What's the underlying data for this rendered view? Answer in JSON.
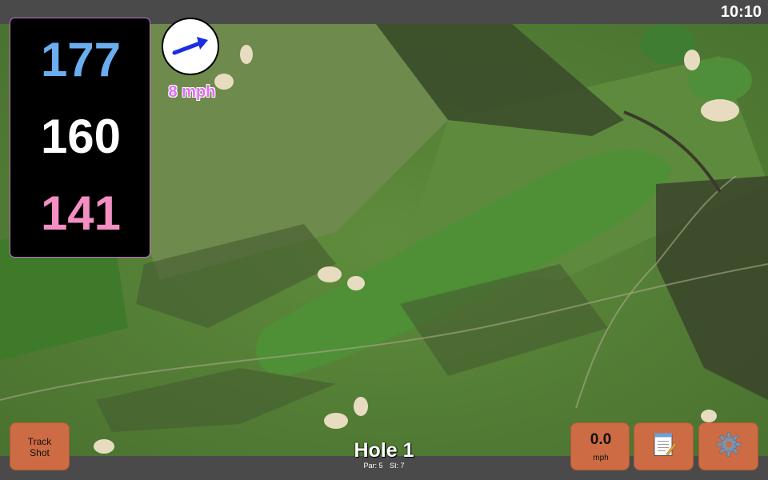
{
  "status": {
    "time": "10:10"
  },
  "distances": {
    "back": "177",
    "middle": "160",
    "front": "141",
    "colors": {
      "back": "#6aaef0",
      "middle": "#ffffff",
      "front": "#f38fc3"
    }
  },
  "wind": {
    "speed_label": "8 mph",
    "arrow_color": "#1a2ee0",
    "icon": "wind-arrow-icon"
  },
  "hole": {
    "title": "Hole 1",
    "par_label": "Par: 5",
    "si_label": "SI: 7"
  },
  "buttons": {
    "track_shot": "Track\nShot",
    "speed_value": "0.0",
    "speed_unit": "mph",
    "notes_icon": "notepad-icon",
    "settings_icon": "gear-icon"
  },
  "colors": {
    "button_bg": "#cd6b44",
    "bar_bg": "#4a4a4a",
    "panel_border": "#c070c8"
  }
}
